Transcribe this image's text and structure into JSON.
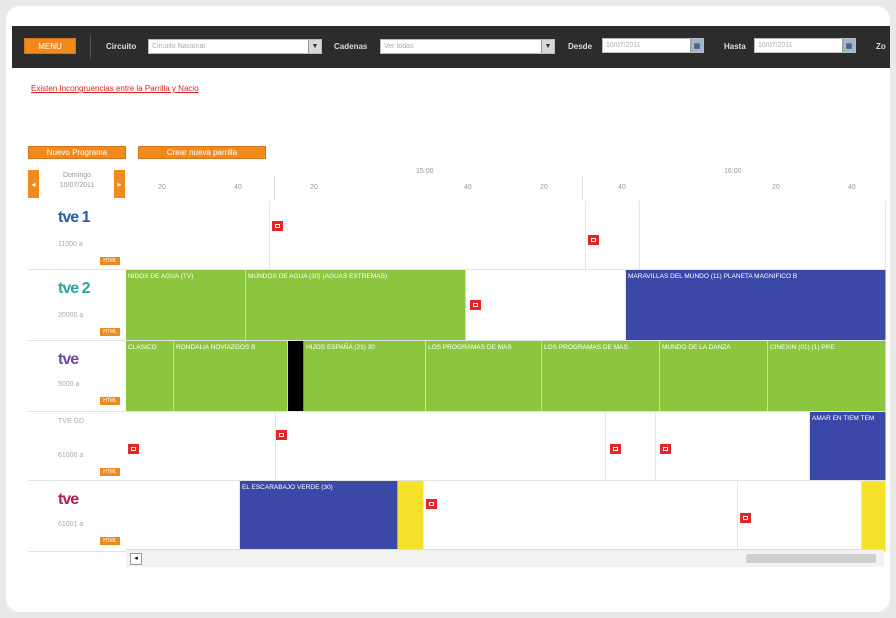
{
  "toolbar": {
    "menu_label": "MENU",
    "circuito_label": "Circuito",
    "circuito_value": "Circuito Nacional",
    "cadenas_label": "Cadenas",
    "cadenas_value": "Ver todas",
    "desde_label": "Desde",
    "desde_value": "10/07/2011",
    "hasta_label": "Hasta",
    "hasta_value": "10/07/2011",
    "zoom_label": "Zo"
  },
  "warning_link": "Existen Incongruencias entre la Parrilla y Nacio",
  "actions": {
    "new_program": "Nuevo Programa",
    "create_grid": "Crear nueva parrilla"
  },
  "date_nav": {
    "weekday": "Domingo",
    "date": "10/07/2011",
    "prev": "◂",
    "next": "▸"
  },
  "timeline": {
    "hours": [
      "15:00",
      "16:00"
    ],
    "minutes": [
      "20",
      "40",
      "20",
      "40",
      "20",
      "40",
      "20",
      "40"
    ]
  },
  "channels": [
    {
      "name": "tve1",
      "logo": "tve 1",
      "share": "11000 a",
      "badge": "HTML"
    },
    {
      "name": "tve2",
      "logo": "tve 2",
      "share": "20000 a",
      "badge": "HTML"
    },
    {
      "name": "tve",
      "logo": "tve",
      "share": "5000 a",
      "badge": "HTML"
    },
    {
      "name": "tvegd",
      "logo": "TVE GD",
      "share": "61000 a",
      "badge": "HTML"
    },
    {
      "name": "tve-int",
      "logo": "tve",
      "share": "61001 a",
      "badge": "HTML"
    }
  ],
  "programs": {
    "row1": [
      "",
      "",
      "",
      ""
    ],
    "row2": [
      "NIDOS DE AGUA (TV)",
      "MUNDOS DE AGUA (30) (AGUAS EXTREMAS)",
      "",
      "MARAVILLAS DEL MUNDO (11) PLANETA MAGNIFICO B"
    ],
    "row3": [
      "CLASICO",
      "RONDALIA NOVIAZGOS B",
      "",
      "HIJOS ESPAÑA (21) 30",
      "LOS PROGRAMAS DE MAS",
      "LOS PROGRAMAS DE MAS",
      "MUNDO DE LA DANZA",
      "CINEXIN (01) (1) PRE"
    ],
    "row4": [
      "",
      "",
      "",
      "",
      "AMAR EN TIEM TEM"
    ],
    "row5": [
      "",
      "EL ESCARABAJO VERDE (30)",
      "",
      "",
      ""
    ]
  },
  "colors": {
    "toolbar": "#2c2c2c",
    "orange": "#f08a1c",
    "green": "#8cc63f",
    "blue": "#3b48a8",
    "yellow": "#f4e32a",
    "red": "#e4262b",
    "warning": "#d22222"
  }
}
